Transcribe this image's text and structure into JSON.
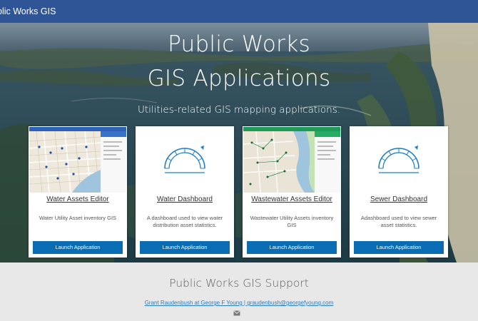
{
  "header": {
    "brand": "blic Works GIS"
  },
  "hero": {
    "title_line1": "Public Works",
    "title_line2": "GIS Applications",
    "subtitle": "Utilities-related GIS mapping applications."
  },
  "cards": [
    {
      "title": "Water Assets Editor",
      "description": "Water Utility Asset inventory GIS",
      "button": "Launch Application",
      "thumb": "map-screenshot"
    },
    {
      "title": "Water Dashboard",
      "description": "A dashboard used to view water distribution asset statistics.",
      "button": "Launch Application",
      "thumb": "gauge-icon"
    },
    {
      "title": "Wastewater Assets Editor",
      "description": "Wastewater Utility Assets inventory GIS",
      "button": "Launch Application",
      "thumb": "map-screenshot"
    },
    {
      "title": "Sewer Dashboard",
      "description": "Adashboard used to view sewer asset statistics.",
      "button": "Launch Application",
      "thumb": "gauge-icon"
    }
  ],
  "footer": {
    "title": "Public Works GIS Support",
    "contact_link": "Grant Raudenbush at George F Young | graudenbush@georgefyoung.com",
    "mail_icon": "envelope-icon"
  },
  "colors": {
    "topbar": "#2f5597",
    "button": "#0a6cb3",
    "link": "#2a7dc0",
    "gauge": "#1f7fc4"
  }
}
